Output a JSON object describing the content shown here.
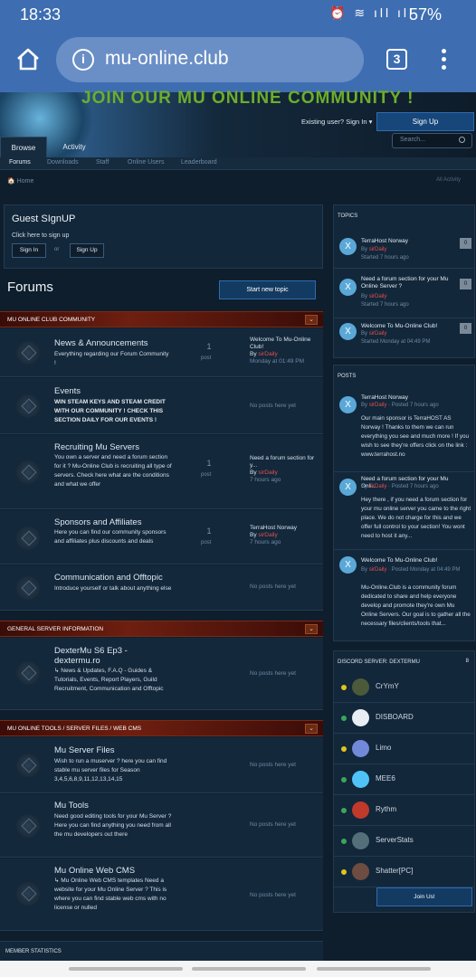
{
  "status": {
    "time": "18:33",
    "battery": "57%",
    "icons": "⏰ ≋ ıll ıll"
  },
  "browser": {
    "url": "mu-online.club",
    "tab_count": "3"
  },
  "header": {
    "banner_text": "JOIN OUR MU ONLINE COMMUNITY !",
    "existing_user": "Existing user? Sign In ▾",
    "signup": "Sign Up",
    "tabs": [
      "Browse",
      "Activity"
    ],
    "search_placeholder": "Search...",
    "subnav": [
      "Forums",
      "Downloads",
      "Staff",
      "Online Users",
      "Leaderboard"
    ],
    "breadcrumb": "🏠 Home",
    "all_activity": "All Activity"
  },
  "guest": {
    "title": "Guest SIgnUP",
    "subtitle": "Click here to sign up",
    "signin": "Sign In",
    "or": "or",
    "signup": "Sign Up"
  },
  "forums": {
    "title": "Forums",
    "new_topic": "Start new topic"
  },
  "categories": [
    {
      "name": "MU ONLINE CLUB COMMUNITY",
      "toggle": "⌄"
    },
    {
      "name": "GENERAL SERVER INFORMATION",
      "toggle": "⌄"
    },
    {
      "name": "MU ONLINE TOOLS / SERVER FILES / WEB CMS",
      "toggle": "⌄"
    }
  ],
  "rows": [
    {
      "title": "News & Announcements",
      "desc": "Everything regarding our Forum Community !",
      "count": "1",
      "count_label": "post",
      "last_title": "Welcome To Mu-Online Club!",
      "last_by": "By",
      "last_user": "sirDaily",
      "last_time": "Monday at 01:49 PM"
    },
    {
      "title": "Events",
      "desc": "WIN STEAM KEYS AND STEAM CREDIT WITH OUR COMMUNITY ! CHECK THIS SECTION DAILY FOR OUR EVENTS !",
      "nop": "No posts here yet"
    },
    {
      "title": "Recruiting Mu Servers",
      "desc": "You own a server and need a forum section for it ? Mu-Online Club is recruiting all type of servers. Check here what are the conditions and what we offer",
      "count": "1",
      "count_label": "post",
      "last_title": "Need a forum section for y...",
      "last_by": "By",
      "last_user": "sirDaily",
      "last_time": "7 hours ago"
    },
    {
      "title": "Sponsors and Affiliates",
      "desc": "Here you can find our community sponsors and affiliates plus discounts and deals",
      "count": "1",
      "count_label": "post",
      "last_title": "TerraHost Norway",
      "last_by": "By",
      "last_user": "sirDaily",
      "last_time": "7 hours ago"
    },
    {
      "title": "Communication and Offtopic",
      "desc": "Introduce yourself or talk about anything else",
      "nop": "No posts here yet"
    },
    {
      "title": "DexterMu S6 Ep3 - dextermu.ro",
      "desc": "↳ News & Updates,  F.A.Q - Guides & Tutorials,  Events,  Report Players,  Guild Recruitment,  Communication and Offtopic",
      "nop": "No posts here yet"
    },
    {
      "title": "Mu Server Files",
      "desc": "Wish to run a muserver ? here you can find stable mu server files for Season 3,4,5,6,8,9,11,12,13,14,15",
      "nop": "No posts here yet"
    },
    {
      "title": "Mu Tools",
      "desc": "Need good editing tools for your Mu Server ? Here you can find anything you need from all the  mu developers out there",
      "nop": "No posts here yet"
    },
    {
      "title": "Mu Online Web CMS",
      "desc": "↳ Mu Online Web CMS templates  Need a website for your Mu Online Server ? This is where you can find stable web cms with no license or nulled",
      "nop": "No posts here yet"
    }
  ],
  "topics": {
    "title": "TOPICS",
    "items": [
      {
        "title": "TerraHost Norway",
        "by": "By",
        "user": "sirDaily",
        "time": "Started 7 hours ago",
        "badge": "0",
        "avatar": "X"
      },
      {
        "title": "Need a forum section for your Mu Online Server ?",
        "by": "By",
        "user": "sirDaily",
        "time": "Started 7 hours ago",
        "badge": "0",
        "avatar": "X"
      },
      {
        "title": "Welcome To Mu-Online Club!",
        "by": "By",
        "user": "sirDaily",
        "time": "Started Monday at 04:49 PM",
        "badge": "0",
        "avatar": "X"
      }
    ]
  },
  "posts": {
    "title": "POSTS",
    "items": [
      {
        "title": "TerraHost Norway",
        "by": "By",
        "user": "sirDaily",
        "time": "· Posted 7 hours ago",
        "body": "Our main sponsor is TerraHOST AS Norway ! Thanks to them we can run everything you see and much more ! If you wish to see they're offers click on the link : www.terrahost.no",
        "avatar": "X"
      },
      {
        "title": "Need a forum section for your Mu Onli...",
        "by": "By",
        "user": "sirDaily",
        "time": "· Posted 7 hours ago",
        "body": "Hey there , if you need a forum section for your mu online server you came to the right place. We do not charge for this and we offer full control to your section! You wont need to host it any...",
        "avatar": "X"
      },
      {
        "title": "Welcome To Mu-Online Club!",
        "by": "By",
        "user": "sirDaily",
        "time": "· Posted Monday at 04:49 PM",
        "body": "Mu-Online.Club is a community forum dedicated to share and help everyone develop and promote they're own Mu Online Servers. Our goal is to gather all the necessary files/clients/tools that...",
        "avatar": "X"
      }
    ]
  },
  "discord": {
    "title": "DISCORD SERVER: DEXTERMU",
    "count": "8",
    "join": "Join Us!",
    "members": [
      {
        "name": "CrYmY",
        "status": "#e0c41c",
        "avatar": "#4c5a3a"
      },
      {
        "name": "DISBOARD",
        "status": "#3ba55c",
        "avatar": "#e8eef4"
      },
      {
        "name": "Limo",
        "status": "#e0c41c",
        "avatar": "#7289da"
      },
      {
        "name": "MEE6",
        "status": "#3ba55c",
        "avatar": "#4fc3f7"
      },
      {
        "name": "Rythm",
        "status": "#3ba55c",
        "avatar": "#c0392b"
      },
      {
        "name": "ServerStats",
        "status": "#3ba55c",
        "avatar": "#546e7a"
      },
      {
        "name": "Shatter[PC]",
        "status": "#e0c41c",
        "avatar": "#6d4c41"
      }
    ]
  },
  "member_stats": "MEMBER STATISTICS"
}
